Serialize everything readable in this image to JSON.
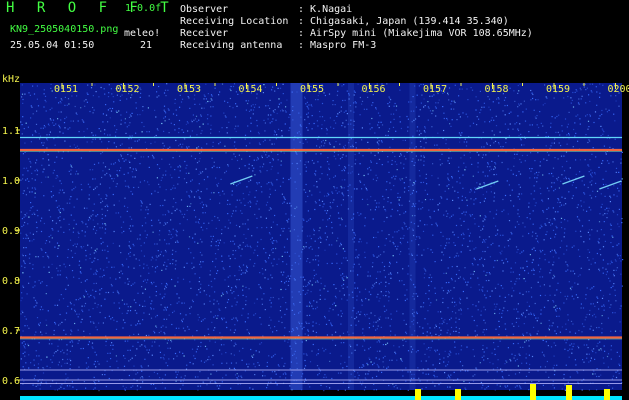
{
  "header": {
    "logo": "H R O F F T",
    "version": "1.0.0f",
    "filename": "KN9_2505040150.png",
    "datetime": "25.05.04 01:50",
    "mode_label": "meleo!",
    "mode_value": "21",
    "info": [
      {
        "label": "Observer",
        "value": ": K.Nagai"
      },
      {
        "label": "Receiving Location",
        "value": ": Chigasaki, Japan (139.414 35.340)"
      },
      {
        "label": "Receiver",
        "value": ": AirSpy mini (Miakejima VOR 108.65MHz)"
      },
      {
        "label": "Receiving antenna",
        "value": ": Maspro FM-3"
      }
    ]
  },
  "chart_data": {
    "type": "heatmap",
    "ylabel": "kHz",
    "yticks": [
      "1.1",
      "1.0",
      "0.9",
      "0.8",
      "0.7",
      "0.6"
    ],
    "yvalues": [
      1.1,
      1.0,
      0.9,
      0.8,
      0.7,
      0.6
    ],
    "xticks": [
      "0151",
      "0152",
      "0153",
      "0154",
      "0155",
      "0156",
      "0157",
      "0158",
      "0159",
      "0200"
    ],
    "carrier_lines_khz": [
      1.085,
      1.06,
      0.685
    ],
    "meteor_traces": [
      {
        "time_min": 2.9,
        "khz": 1.0
      },
      {
        "time_min": 6.9,
        "khz": 0.99
      },
      {
        "time_min": 8.3,
        "khz": 1.0
      },
      {
        "time_min": 8.9,
        "khz": 0.99
      }
    ],
    "colors": {
      "background": "#0a1a8c",
      "noise": "#3a6dff",
      "carrier": "#ff6a3a",
      "ticks": "#f4f44c",
      "gridline": "#b9b9ff",
      "floor": "#00e6ff",
      "peaks": "#ffff00"
    }
  }
}
